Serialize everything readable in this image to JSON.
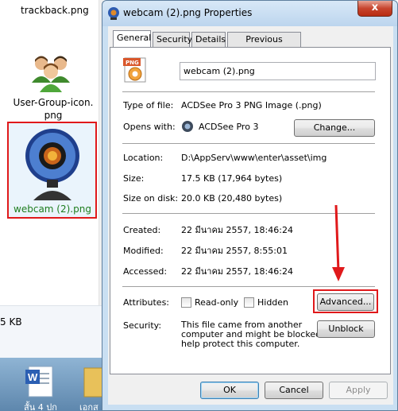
{
  "explorer": {
    "files": [
      {
        "label": "trackback.png"
      },
      {
        "label": "User-Group-icon.png",
        "line1": "User-Group-icon.",
        "line2": "png"
      },
      {
        "label": "webcam (2).png"
      }
    ],
    "status_text": "5 KB",
    "taskbar_items": [
      "สั้น 4 ปก",
      "เอกส"
    ]
  },
  "dialog": {
    "title": "webcam (2).png Properties",
    "close_label": "x",
    "tabs": [
      "General",
      "Security",
      "Details",
      "Previous Versions"
    ],
    "file_icon_badge": "PNG",
    "file_name": "webcam (2).png",
    "type_label": "Type of file:",
    "type_value": "ACDSee Pro 3 PNG Image (.png)",
    "opens_label": "Opens with:",
    "opens_value": "ACDSee Pro 3",
    "change_button": "Change...",
    "location_label": "Location:",
    "location_value": "D:\\AppServ\\www\\enter\\asset\\img",
    "size_label": "Size:",
    "size_value": "17.5 KB (17,964 bytes)",
    "size_disk_label": "Size on disk:",
    "size_disk_value": "20.0 KB (20,480 bytes)",
    "created_label": "Created:",
    "created_value": "22 มีนาคม 2557, 18:46:24",
    "modified_label": "Modified:",
    "modified_value": "22 มีนาคม 2557, 8:55:01",
    "accessed_label": "Accessed:",
    "accessed_value": "22 มีนาคม 2557, 18:46:24",
    "attributes_label": "Attributes:",
    "readonly_label": "Read-only",
    "hidden_label": "Hidden",
    "advanced_button": "Advanced...",
    "security_label": "Security:",
    "security_text": [
      "This file came from another",
      "computer and might be blocked to",
      "help protect this computer."
    ],
    "unblock_button": "Unblock",
    "ok_button": "OK",
    "cancel_button": "Cancel",
    "apply_button": "Apply"
  },
  "colors": {
    "highlight_red": "#e0191b",
    "selected_label_green": "#1e7d1e",
    "dialog_frame": "#c9dff2"
  }
}
